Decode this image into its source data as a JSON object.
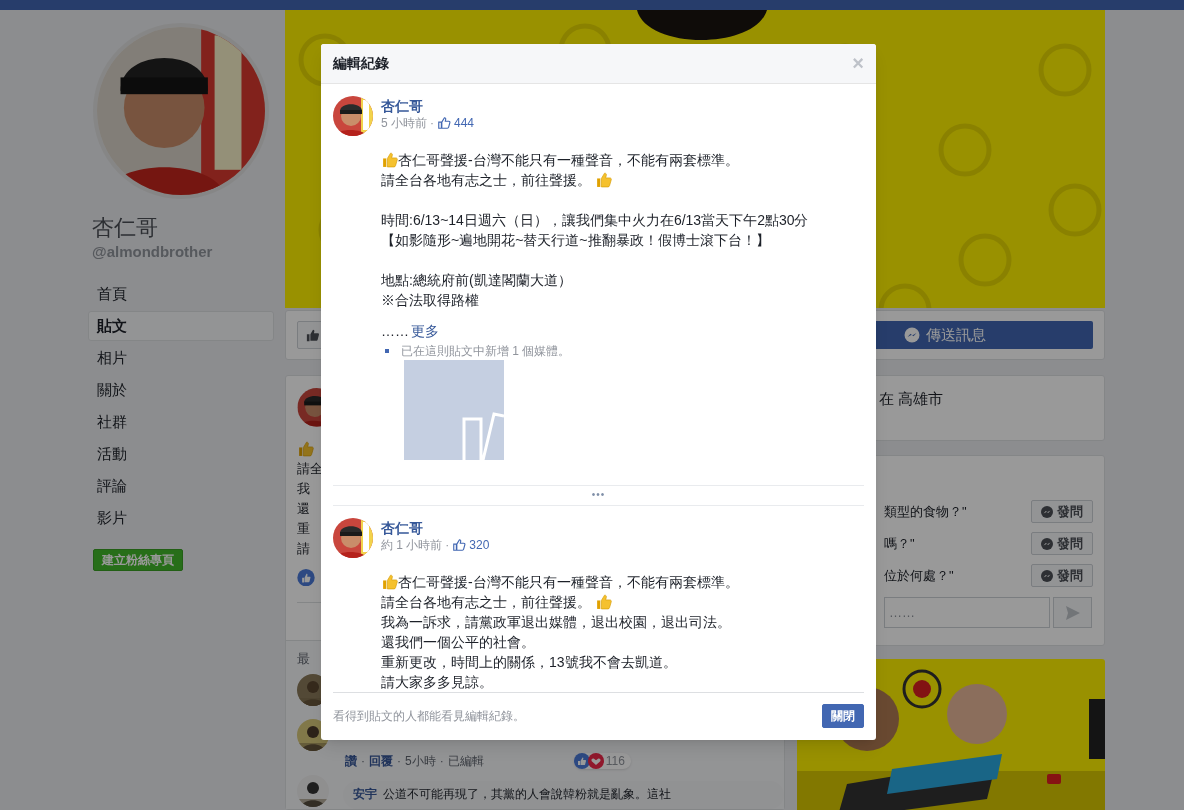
{
  "sidebar": {
    "page_name": "杏仁哥",
    "handle": "@almondbrother",
    "items": [
      {
        "label": "首頁",
        "selected": false
      },
      {
        "label": "貼文",
        "selected": true
      },
      {
        "label": "相片",
        "selected": false
      },
      {
        "label": "關於",
        "selected": false
      },
      {
        "label": "社群",
        "selected": false
      },
      {
        "label": "活動",
        "selected": false
      },
      {
        "label": "評論",
        "selected": false
      },
      {
        "label": "影片",
        "selected": false
      }
    ],
    "create_page_button": "建立粉絲專頁"
  },
  "action_bar": {
    "message_button": "傳送訊息"
  },
  "post": {
    "text_fragments": [
      {
        "kind": "icon"
      },
      {
        "kind": "text",
        "text": "請全"
      },
      {
        "kind": "text",
        "text": "我"
      },
      {
        "kind": "text",
        "text": "還"
      },
      {
        "kind": "text",
        "text": "重"
      },
      {
        "kind": "text",
        "text": "請"
      }
    ],
    "comments_heading": "最",
    "comment_actions": {
      "items": [
        "讚",
        "回覆",
        "5小時",
        "已編輯"
      ],
      "separator": "·",
      "reaction_count": "116"
    },
    "comment": {
      "author": "安宇",
      "text": "公道不可能再現了，其黨的人會說韓粉就是亂象。這社"
    }
  },
  "location_card": {
    "text": "在 高雄市"
  },
  "questions_card": {
    "questions": [
      {
        "text": "類型的食物？\"",
        "button": "發問"
      },
      {
        "text": "嗎？\"",
        "button": "發問"
      },
      {
        "text": "位於何處？\"",
        "button": "發問"
      }
    ],
    "input_placeholder": "……"
  },
  "modal": {
    "title": "編輯紀錄",
    "close": "×",
    "revisions": [
      {
        "author": "杏仁哥",
        "time": "5 小時前",
        "separator": "·",
        "likes": "444",
        "paragraphs": [
          [
            {
              "kind": "lead_icon",
              "text": "杏仁哥聲援-台灣不能只有一種聲音，不能有兩套標準。"
            },
            {
              "kind": "trail_icon",
              "text": "請全台各地有志之士，前往聲援。"
            }
          ],
          [
            {
              "kind": "text",
              "text": "時間:6/13~14日週六（日），讓我們集中火力在6/13當天下午2點30分"
            },
            {
              "kind": "text",
              "text": "【如影隨形~遍地開花~替天行道~推翻暴政！假博士滾下台！】"
            }
          ],
          [
            {
              "kind": "text",
              "text": "地點:總統府前(凱達閣蘭大道）"
            },
            {
              "kind": "text",
              "text": "※合法取得路權"
            }
          ]
        ],
        "more_prefix": "……",
        "more_link": "更多",
        "media_note": "已在這則貼文中新增 1 個媒體。",
        "media_placeholder": true
      },
      {
        "author": "杏仁哥",
        "time": "約 1 小時前",
        "separator": "·",
        "likes": "320",
        "paragraphs": [
          [
            {
              "kind": "lead_icon",
              "text": "杏仁哥聲援-台灣不能只有一種聲音，不能有兩套標準。"
            },
            {
              "kind": "trail_icon",
              "text": "請全台各地有志之士，前往聲援。"
            },
            {
              "kind": "text",
              "text": "我為一訴求，請黨政軍退出媒體，退出校園，退出司法。"
            },
            {
              "kind": "text",
              "text": "還我們一個公平的社會。"
            },
            {
              "kind": "text",
              "text": "重新更改，時間上的關係，13號我不會去凱道。"
            },
            {
              "kind": "text",
              "text": "請大家多多見諒。"
            }
          ]
        ]
      }
    ],
    "expand": "•••",
    "footer_note": "看得到貼文的人都能看見編輯紀錄。",
    "close_button": "關閉"
  }
}
